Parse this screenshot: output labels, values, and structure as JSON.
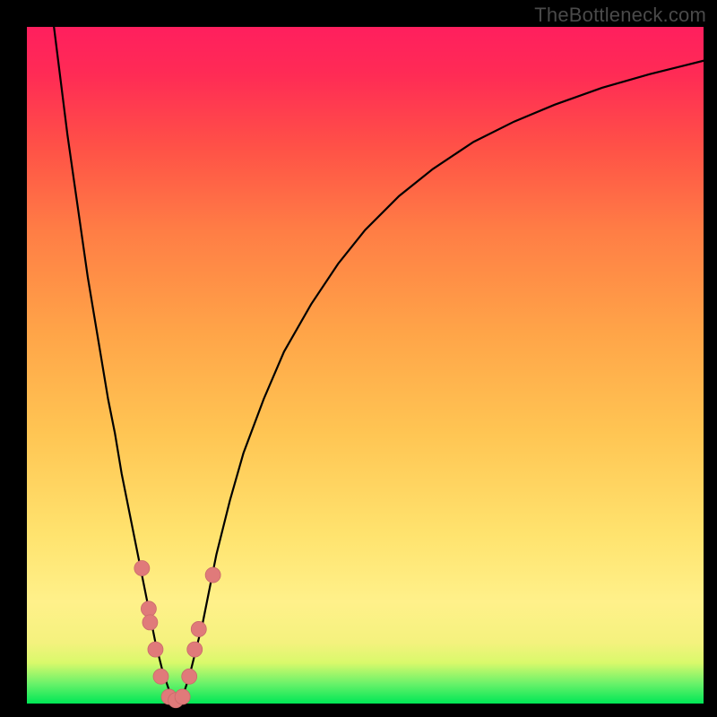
{
  "watermark": "TheBottleneck.com",
  "chart_data": {
    "type": "line",
    "title": "",
    "xlabel": "",
    "ylabel": "",
    "xlim": [
      0,
      100
    ],
    "ylim": [
      0,
      100
    ],
    "curve": {
      "x": [
        4,
        5,
        6,
        7,
        8,
        9,
        10,
        11,
        12,
        13,
        14,
        15,
        16,
        17,
        18,
        19,
        20,
        21,
        22,
        23,
        24,
        25,
        26,
        27,
        28,
        30,
        32,
        35,
        38,
        42,
        46,
        50,
        55,
        60,
        66,
        72,
        78,
        85,
        92,
        100
      ],
      "y": [
        100,
        92,
        84,
        77,
        70,
        63,
        57,
        51,
        45,
        40,
        34,
        29,
        24,
        19,
        14,
        9,
        5,
        2,
        0,
        1,
        4,
        8,
        12,
        17,
        22,
        30,
        37,
        45,
        52,
        59,
        65,
        70,
        75,
        79,
        83,
        86,
        88.5,
        91,
        93,
        95
      ]
    },
    "data_points": {
      "x": [
        17.0,
        18.0,
        18.2,
        19.0,
        19.8,
        21.0,
        22.0,
        23.0,
        24.0,
        24.8,
        25.4,
        27.5
      ],
      "y": [
        20.0,
        14.0,
        12.0,
        8.0,
        4.0,
        1.0,
        0.5,
        1.0,
        4.0,
        8.0,
        11.0,
        19.0
      ]
    },
    "gradient_bands": [
      {
        "position": 0.0,
        "color": "#00e756"
      },
      {
        "position": 0.08,
        "color": "#f4f27e"
      },
      {
        "position": 0.25,
        "color": "#ffe36e"
      },
      {
        "position": 0.55,
        "color": "#ffa448"
      },
      {
        "position": 0.82,
        "color": "#ff5247"
      },
      {
        "position": 1.0,
        "color": "#ff1f5e"
      }
    ]
  }
}
